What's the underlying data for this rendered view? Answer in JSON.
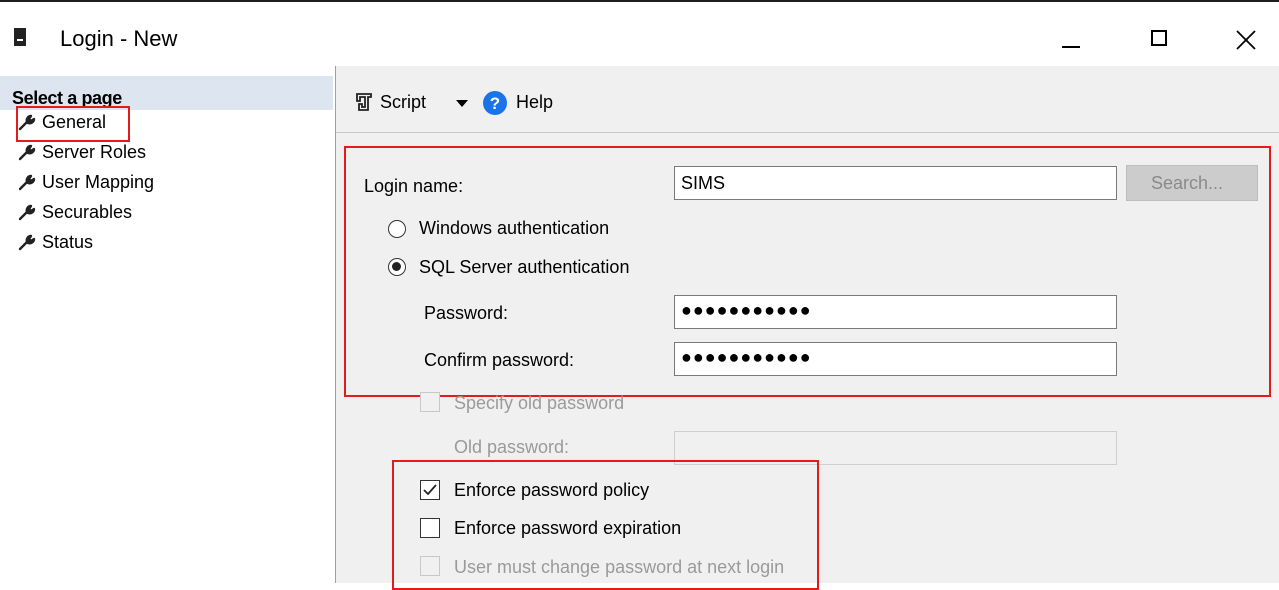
{
  "window": {
    "title": "Login - New",
    "controls": {
      "minimize": "minimize",
      "maximize": "maximize",
      "close": "close"
    }
  },
  "sidebar": {
    "header": "Select a page",
    "items": [
      {
        "label": "General",
        "icon": "wrench-icon",
        "selected": true
      },
      {
        "label": "Server Roles",
        "icon": "wrench-icon"
      },
      {
        "label": "User Mapping",
        "icon": "wrench-icon"
      },
      {
        "label": "Securables",
        "icon": "wrench-icon"
      },
      {
        "label": "Status",
        "icon": "wrench-icon"
      }
    ]
  },
  "toolbar": {
    "script_label": "Script",
    "help_label": "Help"
  },
  "form": {
    "login_name_label": "Login name:",
    "login_name_value": "SIMS",
    "search_button": "Search...",
    "windows_auth_label": "Windows authentication",
    "sql_auth_label": "SQL Server authentication",
    "password_label": "Password:",
    "password_value": "●●●●●●●●●●●",
    "confirm_password_label": "Confirm password:",
    "confirm_password_value": "●●●●●●●●●●●",
    "specify_old_password_label": "Specify old password",
    "old_password_label": "Old password:",
    "enforce_policy_label": "Enforce password policy",
    "enforce_expiration_label": "Enforce password expiration",
    "must_change_label": "User must change password at next login",
    "enforce_policy_checked": true,
    "enforce_expiration_checked": false,
    "must_change_checked": false,
    "sql_auth_selected": true
  },
  "colors": {
    "highlight_red": "#e51b1b",
    "sidebar_header_bg": "#dde6f0",
    "panel_bg": "#f0f0f0",
    "help_icon_blue": "#1a73e8"
  }
}
